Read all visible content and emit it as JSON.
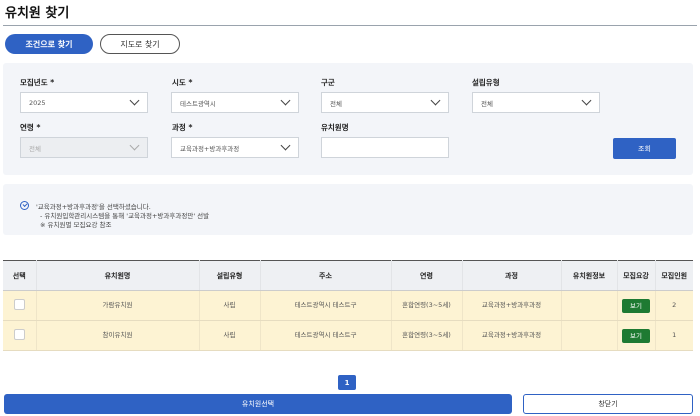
{
  "page": {
    "title": "유치원 찾기"
  },
  "tabs": [
    {
      "label": "조건으로 찾기",
      "active": true
    },
    {
      "label": "지도로 찾기",
      "active": false
    }
  ],
  "filters": {
    "year": {
      "label": "모집년도",
      "value": "2025"
    },
    "region": {
      "label": "시도",
      "value": "테스트광역시"
    },
    "district": {
      "label": "구군",
      "value": "전체"
    },
    "type": {
      "label": "설립유형",
      "value": "전체"
    },
    "age": {
      "label": "연령",
      "value": "전체"
    },
    "course": {
      "label": "과정",
      "value": "교육과정+방과후과정"
    },
    "name": {
      "label": "유치원명",
      "value": ""
    },
    "required_mark": "*",
    "search_label": "조회"
  },
  "notice": {
    "line1": "'교육과정+방과후과정'을 선택하셨습니다.",
    "line2": "- 유치원입학관리시스템을 통해 '교육과정+방과후과정만' 선발",
    "line3": "※ 유치원별 모집요강 참조"
  },
  "table": {
    "headers": [
      "선택",
      "유치원명",
      "설립유형",
      "주소",
      "연령",
      "과정",
      "유치원정보",
      "모집요강",
      "모집인원"
    ],
    "rows": [
      {
        "name": "가람유치원",
        "type": "사립",
        "address": "테스트광역시 테스트구",
        "age": "혼합연령(3~5세)",
        "course": "교육과정+방과후과정",
        "info": "",
        "guide": "보기",
        "count": "2"
      },
      {
        "name": "참이유치원",
        "type": "사립",
        "address": "테스트광역시 테스트구",
        "age": "혼합연령(3~5세)",
        "course": "교육과정+방과후과정",
        "info": "",
        "guide": "보기",
        "count": "1"
      }
    ]
  },
  "pagination": {
    "current": "1"
  },
  "footer": {
    "select_label": "유치원선택",
    "close_label": "창닫기"
  },
  "colors": {
    "primary": "#2f62c4",
    "row_highlight": "#fdf3d3",
    "view_button": "#1e7a32"
  }
}
